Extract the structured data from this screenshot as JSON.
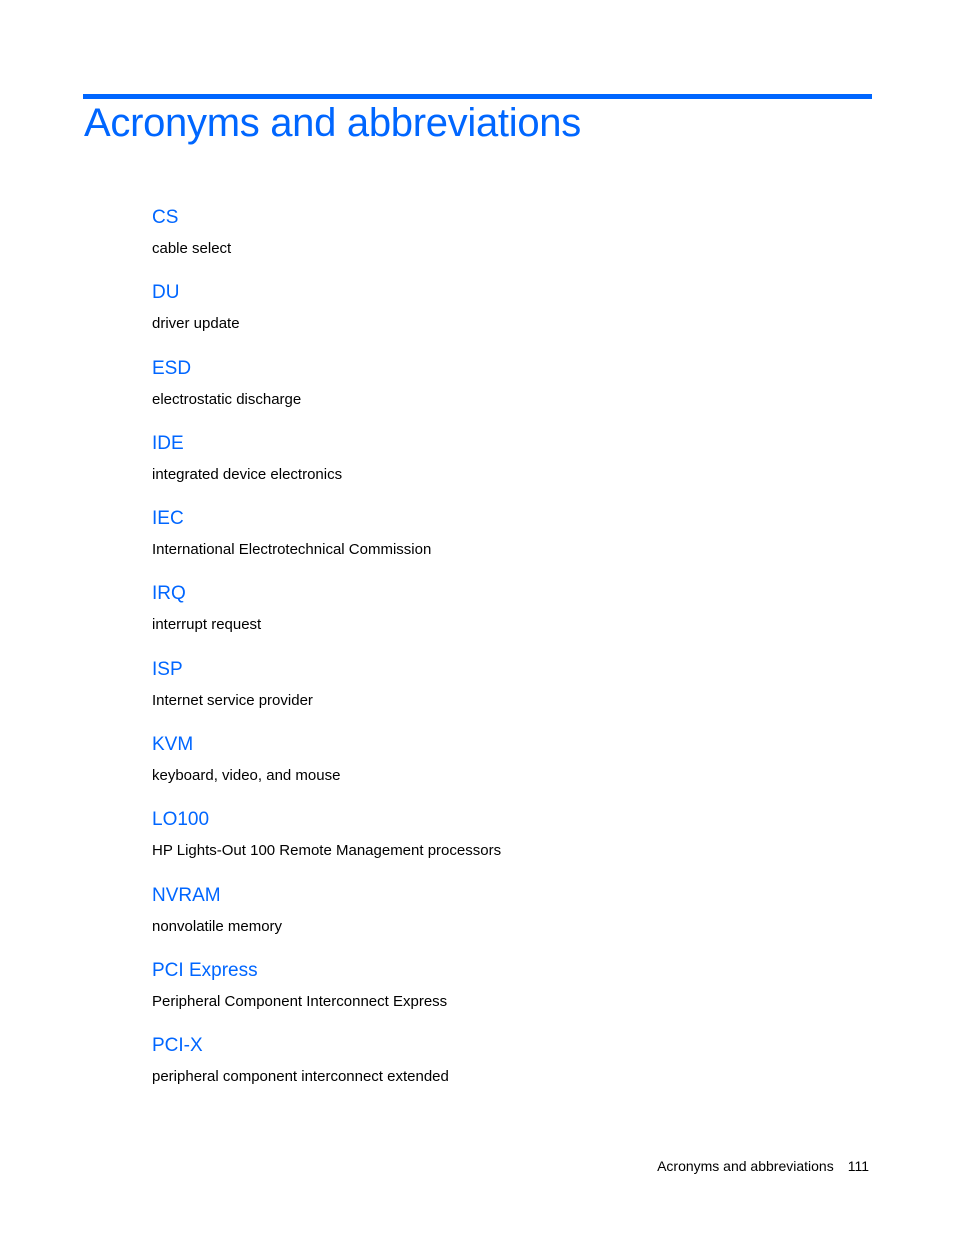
{
  "page": {
    "title": "Acronyms and abbreviations",
    "accent_color": "#0066ff"
  },
  "entries": [
    {
      "term": "CS",
      "definition": "cable select"
    },
    {
      "term": "DU",
      "definition": "driver update"
    },
    {
      "term": "ESD",
      "definition": "electrostatic discharge"
    },
    {
      "term": "IDE",
      "definition": "integrated device electronics"
    },
    {
      "term": "IEC",
      "definition": "International Electrotechnical Commission"
    },
    {
      "term": "IRQ",
      "definition": "interrupt request"
    },
    {
      "term": "ISP",
      "definition": "Internet service provider"
    },
    {
      "term": "KVM",
      "definition": "keyboard, video, and mouse"
    },
    {
      "term": "LO100",
      "definition": "HP Lights-Out 100 Remote Management processors"
    },
    {
      "term": "NVRAM",
      "definition": "nonvolatile memory"
    },
    {
      "term": "PCI Express",
      "definition": "Peripheral Component Interconnect Express"
    },
    {
      "term": "PCI-X",
      "definition": "peripheral component interconnect extended"
    }
  ],
  "footer": {
    "section": "Acronyms and abbreviations",
    "page_number": "111"
  }
}
